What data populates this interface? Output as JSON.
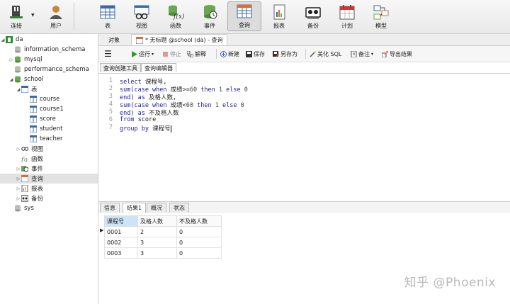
{
  "toolbar": {
    "items": [
      {
        "label": "连接",
        "icon": "connect-icon"
      },
      {
        "label": "用户",
        "icon": "user-icon"
      },
      {
        "label": "表",
        "icon": "table-icon"
      },
      {
        "label": "视图",
        "icon": "view-icon"
      },
      {
        "label": "函数",
        "icon": "function-icon",
        "icon_text": "f(x)"
      },
      {
        "label": "事件",
        "icon": "event-icon"
      },
      {
        "label": "查询",
        "icon": "query-icon"
      },
      {
        "label": "报表",
        "icon": "report-icon"
      },
      {
        "label": "备份",
        "icon": "backup-icon"
      },
      {
        "label": "计划",
        "icon": "schedule-icon"
      },
      {
        "label": "模型",
        "icon": "model-icon"
      }
    ]
  },
  "sidebar": {
    "items": [
      {
        "label": "da"
      },
      {
        "label": "information_schema"
      },
      {
        "label": "mysql"
      },
      {
        "label": "performance_schema"
      },
      {
        "label": "school"
      },
      {
        "label": "表"
      },
      {
        "label": "course"
      },
      {
        "label": "course1"
      },
      {
        "label": "score"
      },
      {
        "label": "student"
      },
      {
        "label": "teacher"
      },
      {
        "label": "视图"
      },
      {
        "label": "函数"
      },
      {
        "label": "事件"
      },
      {
        "label": "查询"
      },
      {
        "label": "报表"
      },
      {
        "label": "备份"
      },
      {
        "label": "sys"
      }
    ]
  },
  "tabs": {
    "objects": "对象",
    "query": "* 无标题 @school (da) - 查询"
  },
  "querybar": {
    "run": "运行",
    "stop": "停止",
    "explain": "解释",
    "new": "新建",
    "save": "保存",
    "save_as": "另存为",
    "beautify": "美化 SQL",
    "comment": "备注",
    "export": "导出结果"
  },
  "subtabs": {
    "builder": "查询创建工具",
    "editor": "查询编辑器"
  },
  "editor": {
    "line_numbers": [
      "1",
      "2",
      "3",
      "4",
      "5",
      "6",
      "7"
    ]
  },
  "result_tabs": [
    "信息",
    "结果1",
    "概况",
    "状态"
  ],
  "result": {
    "headers": [
      "课程号",
      "及格人数",
      "不及格人数"
    ],
    "rows": [
      [
        "0001",
        "2",
        "0"
      ],
      [
        "0002",
        "3",
        "0"
      ],
      [
        "0003",
        "3",
        "0"
      ]
    ]
  },
  "watermark": "知乎 @Phoenix"
}
